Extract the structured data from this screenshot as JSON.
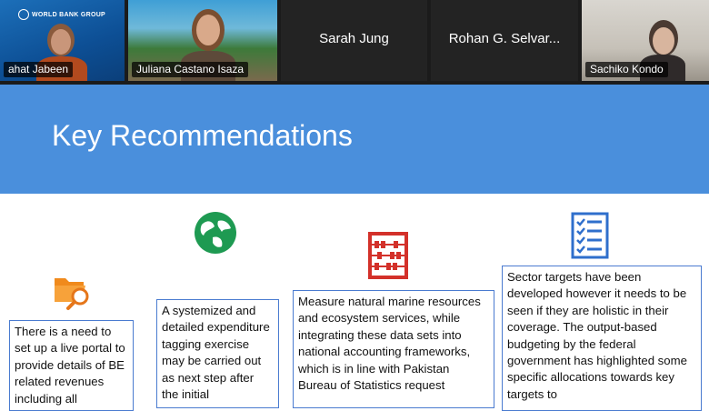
{
  "participants": [
    {
      "name": "ahat Jabeen",
      "logo_text": "WORLD BANK GROUP",
      "video": true
    },
    {
      "name": "Juliana Castano Isaza",
      "video": true
    },
    {
      "name": "Sarah Jung",
      "video": false
    },
    {
      "name": "Rohan G. Selvar...",
      "video": false
    },
    {
      "name": "Sachiko Kondo",
      "video": true
    }
  ],
  "slide": {
    "title": "Key Recommendations",
    "banner_color": "#4a8fdc",
    "recommendations": [
      {
        "icon": "folder-search-icon",
        "text": "There is a need to set up a live portal to provide details of BE related revenues including all"
      },
      {
        "icon": "globe-icon",
        "text": "A systemized and detailed expenditure tagging exercise may be carried out as next step after the initial"
      },
      {
        "icon": "abacus-icon",
        "text": "Measure natural marine resources and ecosystem services, while integrating these data sets into national accounting frameworks, which is in line with Pakistan Bureau of Statistics request"
      },
      {
        "icon": "checklist-icon",
        "text": "Sector targets have been developed however it needs to be seen if they are holistic in their coverage. The output-based budgeting by the federal government has highlighted some specific allocations towards key targets to"
      }
    ]
  }
}
